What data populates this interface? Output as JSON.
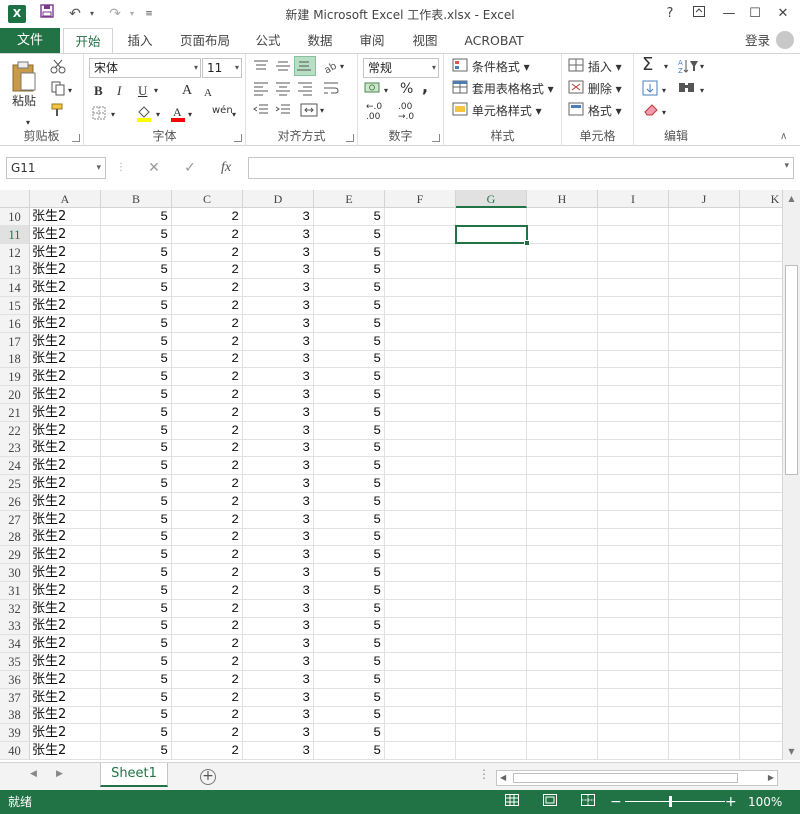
{
  "window": {
    "title": "新建 Microsoft Excel 工作表.xlsx - Excel",
    "app_icon": "X",
    "help": "?",
    "login": "登录"
  },
  "ribbon_tabs": {
    "file": "文件",
    "tabs": [
      "开始",
      "插入",
      "页面布局",
      "公式",
      "数据",
      "审阅",
      "视图",
      "ACROBAT"
    ],
    "active": "开始"
  },
  "ribbon": {
    "clipboard": {
      "paste": "粘贴",
      "label": "剪贴板"
    },
    "font": {
      "name": "宋体",
      "size": "11",
      "label": "字体",
      "bold": "B",
      "italic": "I",
      "underline": "U",
      "grow": "A",
      "shrink": "A",
      "wen": "wén",
      "font_color_accent": "#ff0000",
      "highlight_accent": "#ffff00"
    },
    "alignment": {
      "label": "对齐方式"
    },
    "number": {
      "format": "常规",
      "percent": "%",
      "comma": ",",
      "label": "数字"
    },
    "styles": {
      "conditional": "条件格式",
      "table": "套用表格格式",
      "cell_styles": "单元格样式",
      "label": "样式"
    },
    "cells": {
      "insert": "插入",
      "delete": "删除",
      "format": "格式",
      "label": "单元格"
    },
    "editing": {
      "sigma": "Σ",
      "label": "编辑"
    }
  },
  "formula_bar": {
    "name_box": "G11",
    "fx": "fx",
    "value": ""
  },
  "grid": {
    "columns": [
      "A",
      "B",
      "C",
      "D",
      "E",
      "F",
      "G",
      "H",
      "I",
      "J",
      "K"
    ],
    "selected_column": "G",
    "selected_row": "11",
    "selected_cell": "G11",
    "rows": [
      {
        "num": "10",
        "a": "张生2",
        "b": "5",
        "c": "2",
        "d": "3",
        "e": "5"
      },
      {
        "num": "11",
        "a": "张生2",
        "b": "5",
        "c": "2",
        "d": "3",
        "e": "5"
      },
      {
        "num": "12",
        "a": "张生2",
        "b": "5",
        "c": "2",
        "d": "3",
        "e": "5"
      },
      {
        "num": "13",
        "a": "张生2",
        "b": "5",
        "c": "2",
        "d": "3",
        "e": "5"
      },
      {
        "num": "14",
        "a": "张生2",
        "b": "5",
        "c": "2",
        "d": "3",
        "e": "5"
      },
      {
        "num": "15",
        "a": "张生2",
        "b": "5",
        "c": "2",
        "d": "3",
        "e": "5"
      },
      {
        "num": "16",
        "a": "张生2",
        "b": "5",
        "c": "2",
        "d": "3",
        "e": "5"
      },
      {
        "num": "17",
        "a": "张生2",
        "b": "5",
        "c": "2",
        "d": "3",
        "e": "5"
      },
      {
        "num": "18",
        "a": "张生2",
        "b": "5",
        "c": "2",
        "d": "3",
        "e": "5"
      },
      {
        "num": "19",
        "a": "张生2",
        "b": "5",
        "c": "2",
        "d": "3",
        "e": "5"
      },
      {
        "num": "20",
        "a": "张生2",
        "b": "5",
        "c": "2",
        "d": "3",
        "e": "5"
      },
      {
        "num": "21",
        "a": "张生2",
        "b": "5",
        "c": "2",
        "d": "3",
        "e": "5"
      },
      {
        "num": "22",
        "a": "张生2",
        "b": "5",
        "c": "2",
        "d": "3",
        "e": "5"
      },
      {
        "num": "23",
        "a": "张生2",
        "b": "5",
        "c": "2",
        "d": "3",
        "e": "5"
      },
      {
        "num": "24",
        "a": "张生2",
        "b": "5",
        "c": "2",
        "d": "3",
        "e": "5"
      },
      {
        "num": "25",
        "a": "张生2",
        "b": "5",
        "c": "2",
        "d": "3",
        "e": "5"
      },
      {
        "num": "26",
        "a": "张生2",
        "b": "5",
        "c": "2",
        "d": "3",
        "e": "5"
      },
      {
        "num": "27",
        "a": "张生2",
        "b": "5",
        "c": "2",
        "d": "3",
        "e": "5"
      },
      {
        "num": "28",
        "a": "张生2",
        "b": "5",
        "c": "2",
        "d": "3",
        "e": "5"
      },
      {
        "num": "29",
        "a": "张生2",
        "b": "5",
        "c": "2",
        "d": "3",
        "e": "5"
      },
      {
        "num": "30",
        "a": "张生2",
        "b": "5",
        "c": "2",
        "d": "3",
        "e": "5"
      },
      {
        "num": "31",
        "a": "张生2",
        "b": "5",
        "c": "2",
        "d": "3",
        "e": "5"
      },
      {
        "num": "32",
        "a": "张生2",
        "b": "5",
        "c": "2",
        "d": "3",
        "e": "5"
      },
      {
        "num": "33",
        "a": "张生2",
        "b": "5",
        "c": "2",
        "d": "3",
        "e": "5"
      },
      {
        "num": "34",
        "a": "张生2",
        "b": "5",
        "c": "2",
        "d": "3",
        "e": "5"
      },
      {
        "num": "35",
        "a": "张生2",
        "b": "5",
        "c": "2",
        "d": "3",
        "e": "5"
      },
      {
        "num": "36",
        "a": "张生2",
        "b": "5",
        "c": "2",
        "d": "3",
        "e": "5"
      },
      {
        "num": "37",
        "a": "张生2",
        "b": "5",
        "c": "2",
        "d": "3",
        "e": "5"
      },
      {
        "num": "38",
        "a": "张生2",
        "b": "5",
        "c": "2",
        "d": "3",
        "e": "5"
      },
      {
        "num": "39",
        "a": "张生2",
        "b": "5",
        "c": "2",
        "d": "3",
        "e": "5"
      },
      {
        "num": "40",
        "a": "张生2",
        "b": "5",
        "c": "2",
        "d": "3",
        "e": "5"
      }
    ]
  },
  "sheets": {
    "tabs": [
      "Sheet1"
    ],
    "active": "Sheet1",
    "add": "+"
  },
  "status": {
    "text": "就绪",
    "zoom": "100%",
    "zoom_fraction": 0.5,
    "accent": "#217346"
  }
}
